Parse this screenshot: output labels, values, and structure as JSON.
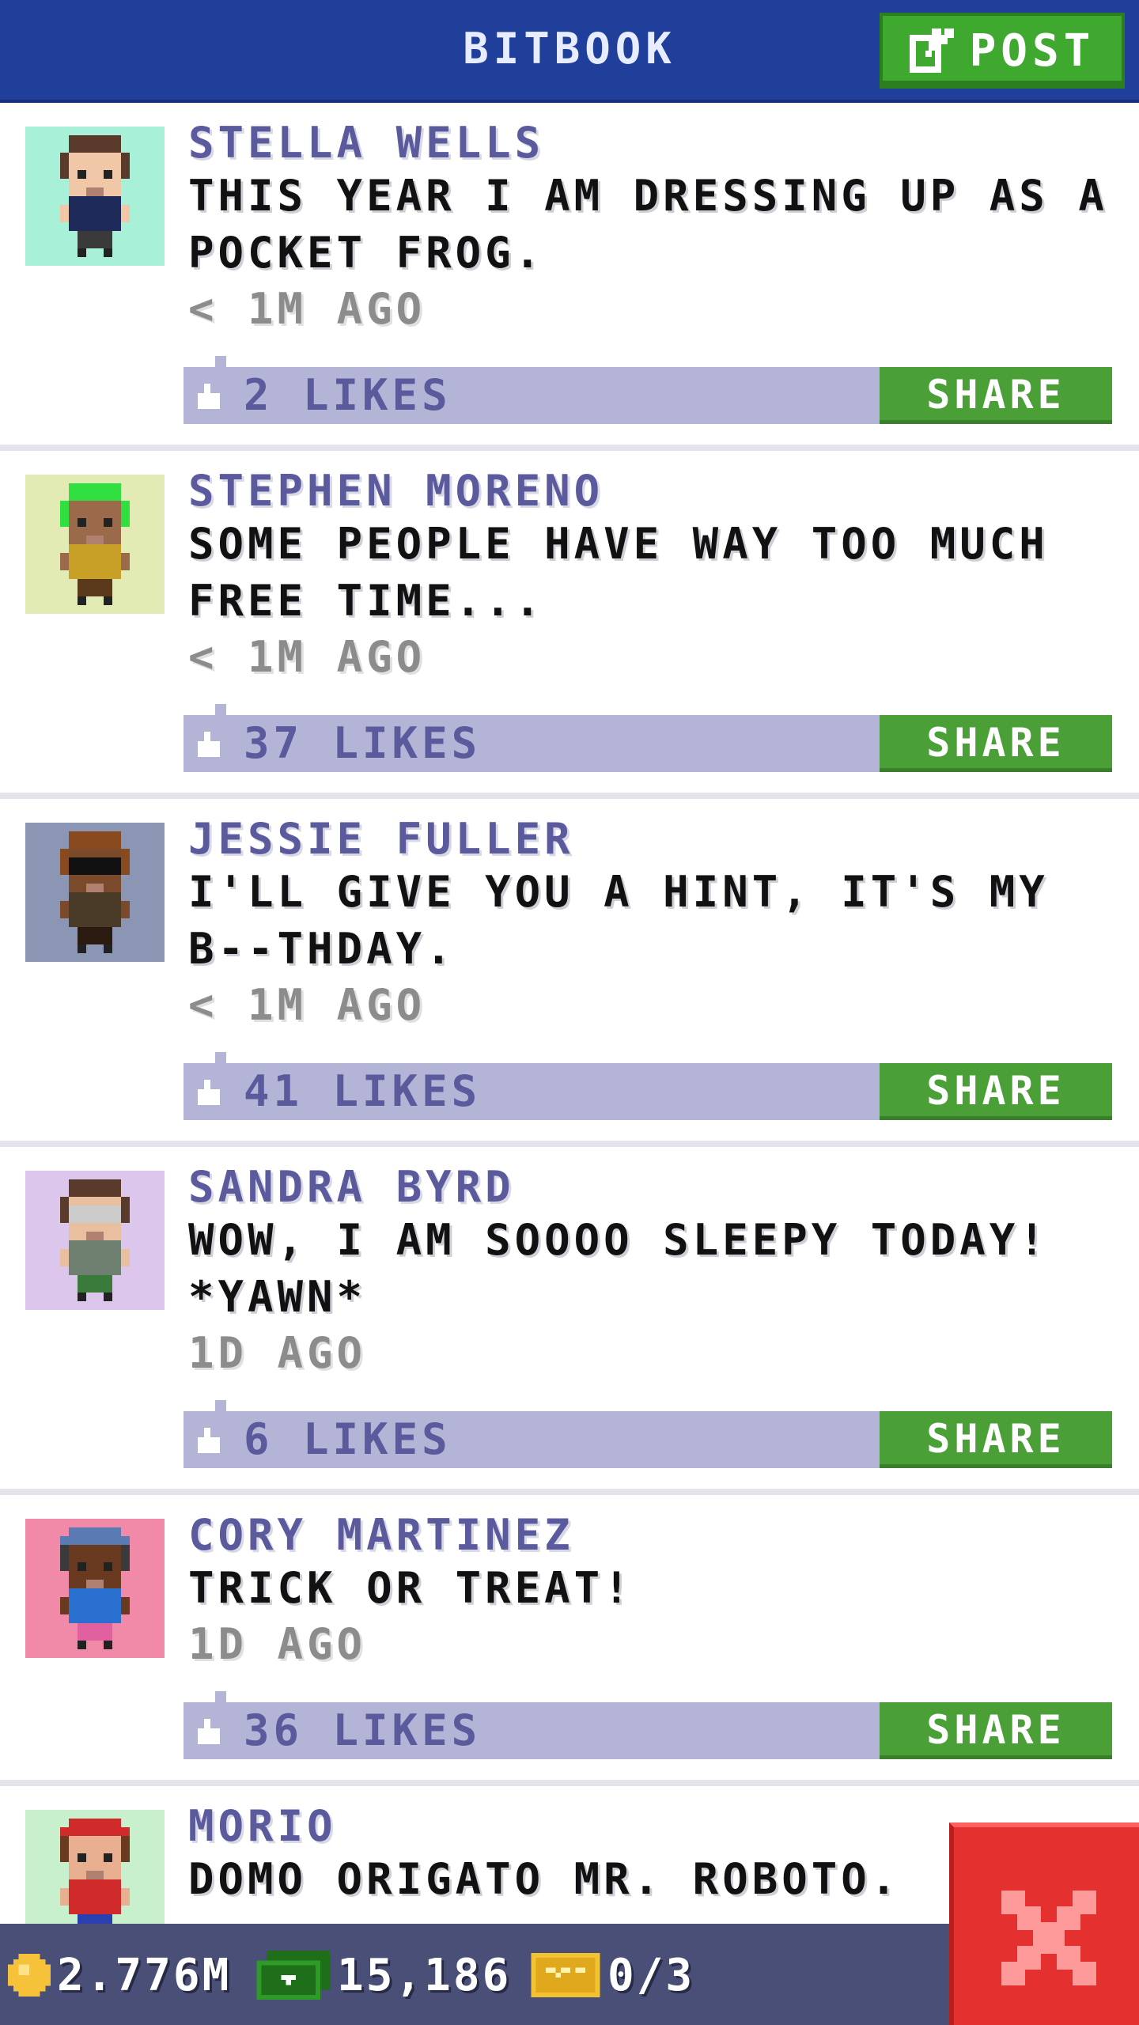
{
  "header": {
    "title": "BITBOOK",
    "post_label": "POST"
  },
  "posts": [
    {
      "author": "STELLA WELLS",
      "line1": "THIS YEAR I AM DRESSING UP AS A",
      "line2": "POCKET FROG.",
      "time": "< 1M AGO",
      "likes": "2 LIKES",
      "share": "SHARE",
      "avatar_bg": "#a8f0d8"
    },
    {
      "author": "STEPHEN MORENO",
      "line1": "SOME PEOPLE HAVE WAY TOO MUCH",
      "line2": "FREE TIME...",
      "time": "< 1M AGO",
      "likes": "37 LIKES",
      "share": "SHARE",
      "avatar_bg": "#e3ebb4"
    },
    {
      "author": "JESSIE FULLER",
      "line1": "I'LL GIVE YOU A HINT, IT'S MY",
      "line2": "B--THDAY.",
      "time": "< 1M AGO",
      "likes": "41 LIKES",
      "share": "SHARE",
      "avatar_bg": "#8a96b4"
    },
    {
      "author": "SANDRA BYRD",
      "line1": "WOW, I AM SOOOO SLEEPY TODAY!",
      "line2": "*YAWN*",
      "time": "1D AGO",
      "likes": "6 LIKES",
      "share": "SHARE",
      "avatar_bg": "#dcc6ec"
    },
    {
      "author": "CORY MARTINEZ",
      "line1": "TRICK OR TREAT!",
      "time": "1D AGO",
      "likes": "36 LIKES",
      "share": "SHARE",
      "avatar_bg": "#f08aa8"
    },
    {
      "author": "MORIO",
      "line1": "DOMO ORIGATO MR. ROBOTO.",
      "avatar_bg": "#c8f0cc"
    }
  ],
  "status": {
    "coins": "2.776M",
    "bux": "15,186",
    "tickets": "0/3"
  },
  "colors": {
    "header": "#1f3f9a",
    "accent_green": "#3fa82e",
    "like_bar": "#b3b4d6",
    "close_red": "#e53030"
  },
  "icons": {
    "post": "compose-icon",
    "like": "thumbs-up-icon",
    "coin": "coin-icon",
    "bux": "bux-icon",
    "ticket": "ticket-icon",
    "close": "close-icon"
  }
}
